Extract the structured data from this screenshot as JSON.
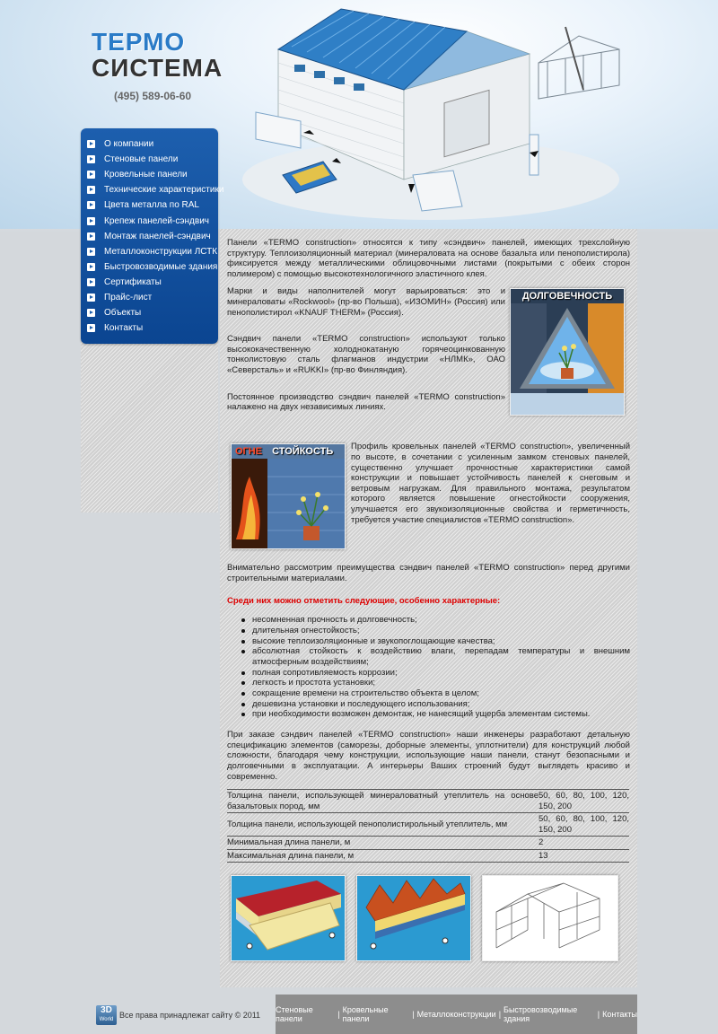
{
  "logo": {
    "line1": "ТЕРМО",
    "line2": "СИСТЕМА"
  },
  "phone": "(495) 589-06-60",
  "menu": [
    {
      "label": "О компании"
    },
    {
      "label": "Стеновые панели"
    },
    {
      "label": "Кровельные панели"
    },
    {
      "label": "Технические характеристики"
    },
    {
      "label": "Цвета металла по RAL"
    },
    {
      "label": "Крепеж панелей-сэндвич"
    },
    {
      "label": "Монтаж панелей-сэндвич"
    },
    {
      "label": "Металлоконструкции ЛСТК"
    },
    {
      "label": "Быстровозводимые здания"
    },
    {
      "label": "Сертификаты"
    },
    {
      "label": "Прайс-лист"
    },
    {
      "label": "Объекты"
    },
    {
      "label": "Контакты"
    }
  ],
  "content": {
    "p1": "Панели «TERMO construction» относятся к типу «сэндвич» панелей, имеющих трехслойную структуру. Теплоизоляционный материал (минераловата на основе базальта или пенополистирола) фиксируется между металлическими облицовочными листами (покрытыми с обеих сторон полимером) с помощью высокотехнологичного эластичного клея.",
    "p2": "Марки и виды наполнителей могут варьироваться: это и минераловаты «Rockwool» (пр-во Польша), «ИЗОМИН» (Россия) или пенополистирол «KNAUF THERM» (Россия).",
    "p3": "Сэндвич панели «TERMO construction» используют только высококачественную холоднокатаную горячеоцинкованную тонколистовую сталь флагманов индустрии «НЛМК», ОАО «Северсталь» и «RUKKI» (пр-во Финляндия).",
    "p4": "Постоянное производство сэндвич панелей «TERMO construction» налажено на двух независимых линиях.",
    "p5": "Профиль кровельных панелей «TERMO construction», увеличенный по высоте, в сочетании с усиленным замком стеновых панелей, существенно улучшает прочностные характеристики самой конструкции и повышает устойчивость панелей к снеговым и ветровым нагрузкам. Для правильного монтажа, результатом которого является повышение огнестойкости сооружения, улучшается его звукоизоляционные свойства и герметичность, требуется участие специалистов «TERMO construction».",
    "p6": "Внимательно рассмотрим преимущества сэндвич панелей «TERMO construction» перед другими строительными материалами.",
    "red_heading": "Среди них можно отметить следующие, особенно характерные:",
    "advantages": [
      "несомненная прочность и долговечность;",
      "длительная огнестойкость;",
      "высокие теплоизоляционные и звукопоглощающие качества;",
      "абсолютная стойкость к воздействию влаги, перепадам температуры и внешним атмосферным воздействиям;",
      "полная сопротивляемость коррозии;",
      "легкость и простота установки;",
      "сокращение времени на строительство объекта в целом;",
      "дешевизна установки и последующего использования;",
      "при необходимости возможен демонтаж, не нанесящий ущерба элементам системы."
    ],
    "p7": "При заказе сэндвич панелей «TERMO construction» наши инженеры разработают детальную спецификацию элементов (саморезы, доборные элементы, уплотнители) для конструкций любой сложности, благодаря чему конструкции, использующие наши панели, станут безопасными и долговечными в эксплуатации. А интерьеры Ваших строений будут выглядеть красиво и современно.",
    "img1_label": "ДОЛГОВЕЧНОСТЬ",
    "img2_label_a": "ОГНЕ",
    "img2_label_b": "СТОЙКОСТЬ"
  },
  "spec_table": [
    {
      "param": "Толщина панели, использующей минераловатный утеплитель на основе базальтовых пород, мм",
      "value": "50, 60, 80, 100, 120, 150, 200"
    },
    {
      "param": "Толщина панели, использующей пенополистирольный утеплитель, мм",
      "value": "50, 60, 80, 100, 120, 150, 200"
    },
    {
      "param": "Минимальная длина панели, м",
      "value": "2"
    },
    {
      "param": "Максимальная длина панели, м",
      "value": "13"
    }
  ],
  "footer": {
    "logo_text": "3D",
    "logo_sub": "World",
    "copyright": "Все права принадлежат сайту © 2011",
    "links": [
      "Стеновые панели",
      "Кровельные панели",
      "Металлоконструкции",
      "Быстровозводимые здания",
      "Контакты"
    ]
  },
  "colors": {
    "menu_blue": "#0b4591",
    "accent_blue": "#2a7bc7",
    "red": "#dd0000",
    "footer_gray": "#8d8d8d"
  }
}
